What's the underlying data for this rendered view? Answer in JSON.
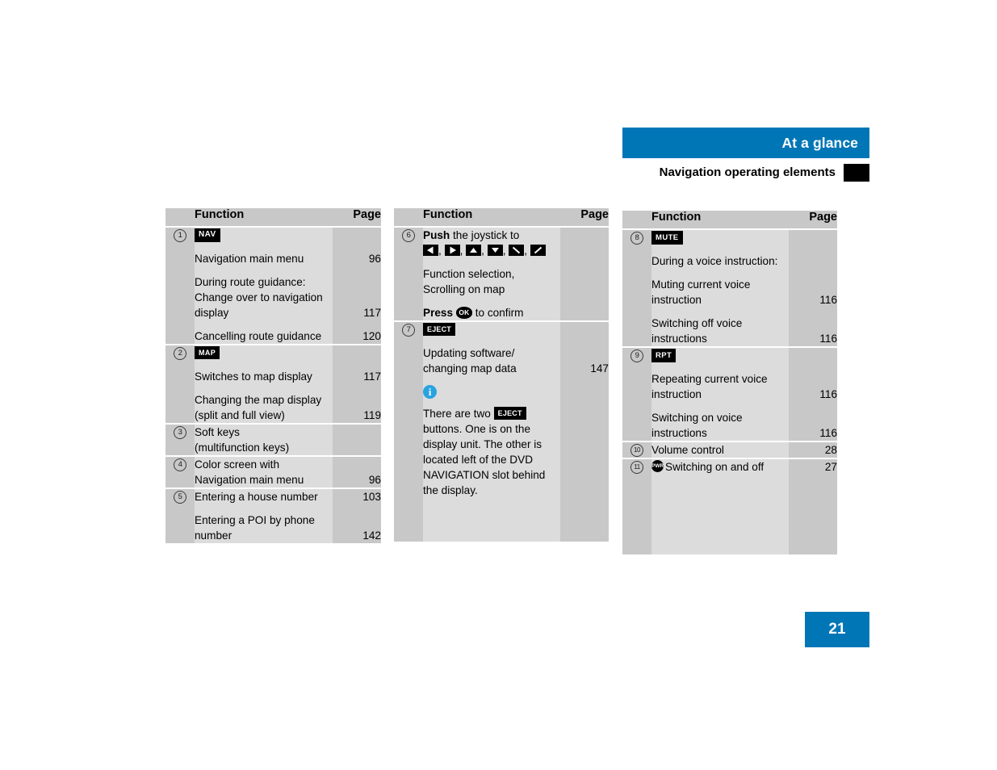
{
  "header": {
    "title": "At a glance",
    "subtitle": "Navigation operating elements"
  },
  "page_number": "21",
  "table_headers": {
    "function": "Function",
    "page": "Page"
  },
  "icons": {
    "nav": "NAV",
    "map": "MAP",
    "eject": "EJECT",
    "mute": "MUTE",
    "rpt": "RPT",
    "ok": "OK",
    "pwr": "PWR",
    "info": "i"
  },
  "columns": [
    {
      "id": "column-1",
      "rows": [
        {
          "num": "1",
          "blocks": [
            {
              "type": "badge",
              "badge": "nav"
            },
            {
              "type": "text",
              "lines": [
                "Navigation main menu"
              ],
              "page": "96"
            },
            {
              "type": "text",
              "lines": [
                "During route guidance:",
                "Change over to navigation",
                "display"
              ],
              "page": "117",
              "page_on_line": 3
            },
            {
              "type": "text",
              "lines": [
                "Cancelling route guidance"
              ],
              "page": "120"
            }
          ]
        },
        {
          "num": "2",
          "blocks": [
            {
              "type": "badge",
              "badge": "map"
            },
            {
              "type": "text",
              "lines": [
                "Switches to map display"
              ],
              "page": "117"
            },
            {
              "type": "text",
              "lines": [
                "Changing the map display",
                "(split and full view)"
              ],
              "page": "119",
              "page_on_line": 2
            }
          ]
        },
        {
          "num": "3",
          "blocks": [
            {
              "type": "text",
              "lines": [
                "Soft keys",
                "(multifunction keys)"
              ],
              "page": ""
            }
          ]
        },
        {
          "num": "4",
          "blocks": [
            {
              "type": "text",
              "lines": [
                "Color screen with",
                "Navigation main menu"
              ],
              "page": "96",
              "page_on_line": 2
            }
          ]
        },
        {
          "num": "5",
          "blocks": [
            {
              "type": "text",
              "lines": [
                "Entering a house number"
              ],
              "page": "103"
            },
            {
              "type": "text",
              "lines": [
                "Entering a POI by phone",
                "number"
              ],
              "page": "142",
              "page_on_line": 2
            }
          ]
        }
      ]
    },
    {
      "id": "column-2",
      "rows": [
        {
          "num": "6",
          "blocks": [
            {
              "type": "push",
              "bold": "Push",
              "rest": " the joystick to",
              "arrows": [
                "left",
                "right",
                "up",
                "down",
                "diag-down-right",
                "diag-up-right"
              ]
            },
            {
              "type": "text",
              "lines": [
                "Function selection,",
                "Scrolling on map"
              ],
              "page": ""
            },
            {
              "type": "press",
              "bold": "Press",
              "rest": " to confirm",
              "button": "OK"
            }
          ]
        },
        {
          "num": "7",
          "blocks": [
            {
              "type": "badge",
              "badge": "eject"
            },
            {
              "type": "text",
              "lines": [
                "Updating software/",
                "changing map data"
              ],
              "page": "147",
              "page_on_line": 2
            },
            {
              "type": "info"
            },
            {
              "type": "note",
              "lines": [
                "There are two ",
                "buttons. One is on the",
                "display unit. The other is",
                "located left of the DVD",
                "NAVIGATION slot behind",
                "the display."
              ],
              "inline_badge_after_line": 1,
              "inline_badge": "eject"
            }
          ]
        }
      ]
    },
    {
      "id": "column-3",
      "rows": [
        {
          "num": "8",
          "blocks": [
            {
              "type": "badge",
              "badge": "mute"
            },
            {
              "type": "text",
              "lines": [
                "During a voice instruction:"
              ],
              "page": ""
            },
            {
              "type": "text",
              "lines": [
                "Muting current voice",
                "instruction"
              ],
              "page": "116",
              "page_on_line": 2
            },
            {
              "type": "text",
              "lines": [
                "Switching off voice",
                "instructions"
              ],
              "page": "116",
              "page_on_line": 2
            }
          ]
        },
        {
          "num": "9",
          "blocks": [
            {
              "type": "badge",
              "badge": "rpt"
            },
            {
              "type": "text",
              "lines": [
                "Repeating current voice",
                "instruction"
              ],
              "page": "116",
              "page_on_line": 2
            },
            {
              "type": "text",
              "lines": [
                "Switching on voice",
                "instructions"
              ],
              "page": "116",
              "page_on_line": 2
            }
          ]
        },
        {
          "num": "10",
          "blocks": [
            {
              "type": "text",
              "lines": [
                "Volume control"
              ],
              "page": "28"
            }
          ]
        },
        {
          "num": "11",
          "blocks": [
            {
              "type": "pwr",
              "text": "Switching on and off",
              "page": "27"
            }
          ]
        }
      ]
    }
  ]
}
